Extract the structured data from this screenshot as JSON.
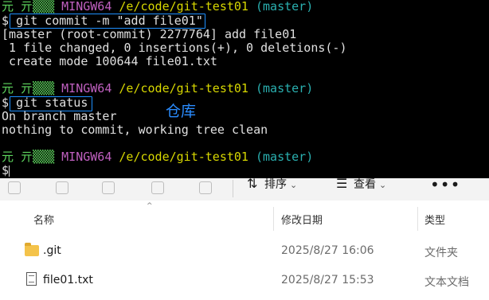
{
  "terminal": {
    "prompt1": {
      "user": "元 亓",
      "host": "MINGW64",
      "path": "/e/code/git-test01",
      "branch": "(master)"
    },
    "cmd1": "git commit -m \"add file01\"",
    "out1": [
      "[master (root-commit) 2277764] add file01",
      " 1 file changed, 0 insertions(+), 0 deletions(-)",
      " create mode 100644 file01.txt"
    ],
    "prompt2": {
      "user": "元 亓",
      "host": "MINGW64",
      "path": "/e/code/git-test01",
      "branch": "(master)"
    },
    "cmd2": "git status",
    "out2": [
      "On branch master",
      "nothing to commit, working tree clean"
    ],
    "prompt3": {
      "user": "元 亓",
      "host": "MINGW64",
      "path": "/e/code/git-test01",
      "branch": "(master)"
    },
    "dollar": "$",
    "annotation": "仓库"
  },
  "toolbar": {
    "sort_label": "排序",
    "view_label": "查看",
    "more_label": "•••"
  },
  "files": {
    "headers": {
      "name": "名称",
      "modified": "修改日期",
      "type": "类型"
    },
    "rows": [
      {
        "name": ".git",
        "modified": "2025/8/27 16:06",
        "type": "文件夹",
        "icon": "folder-icon"
      },
      {
        "name": "file01.txt",
        "modified": "2025/8/27 15:53",
        "type": "文本文档",
        "icon": "text-file-icon"
      }
    ]
  },
  "colors": {
    "accent_box": "#1e90ff",
    "prompt_user": "#5fd75f",
    "prompt_host": "#c060c0",
    "prompt_path": "#d7d700",
    "prompt_branch": "#2ab0b0"
  }
}
